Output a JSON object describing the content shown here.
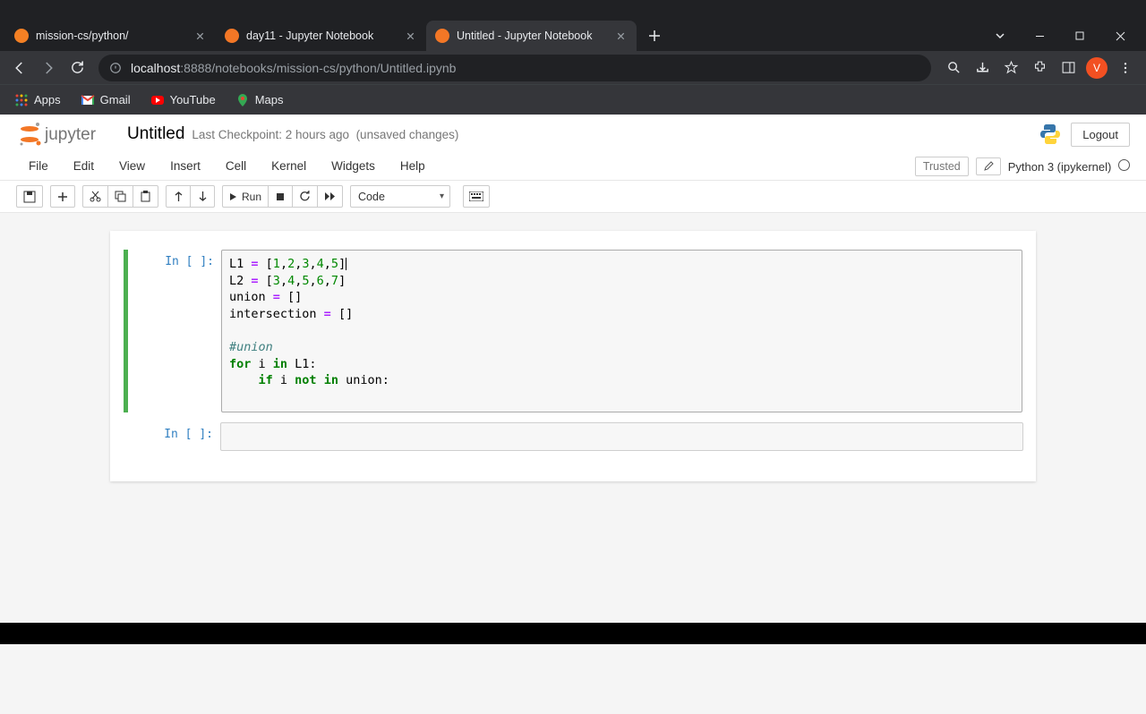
{
  "browser": {
    "tabs": [
      {
        "label": "mission-cs/python/",
        "favicon_color": "#f48024"
      },
      {
        "label": "day11 - Jupyter Notebook",
        "favicon_color": "#f37726"
      },
      {
        "label": "Untitled - Jupyter Notebook",
        "favicon_color": "#f37726"
      }
    ],
    "active_tab": 2,
    "url_host": "localhost",
    "url_port": ":8888",
    "url_path": "/notebooks/mission-cs/python/Untitled.ipynb",
    "avatar_letter": "V",
    "bookmarks": [
      {
        "label": "Apps",
        "icon": "apps"
      },
      {
        "label": "Gmail",
        "icon": "gmail"
      },
      {
        "label": "YouTube",
        "icon": "youtube"
      },
      {
        "label": "Maps",
        "icon": "maps"
      }
    ]
  },
  "jupyter": {
    "title": "Untitled",
    "checkpoint": "Last Checkpoint: 2 hours ago",
    "unsaved": "(unsaved changes)",
    "logout": "Logout",
    "menus": [
      "File",
      "Edit",
      "View",
      "Insert",
      "Cell",
      "Kernel",
      "Widgets",
      "Help"
    ],
    "trusted": "Trusted",
    "kernel": "Python 3 (ipykernel)",
    "run_label": "Run",
    "celltype": "Code",
    "cells": [
      {
        "prompt": "In [ ]:",
        "selected": true,
        "lines": [
          {
            "t": "assign",
            "raw": "L1 = [1,2,3,4,5]"
          },
          {
            "t": "assign",
            "raw": "L2 = [3,4,5,6,7]"
          },
          {
            "t": "assign",
            "raw": "union = []"
          },
          {
            "t": "assign",
            "raw": "intersection = []"
          },
          {
            "t": "blank",
            "raw": ""
          },
          {
            "t": "comment",
            "raw": "#union"
          },
          {
            "t": "for",
            "raw": "for i in L1:"
          },
          {
            "t": "if",
            "raw": "    if i not in union:"
          },
          {
            "t": "blank",
            "raw": "        "
          }
        ]
      },
      {
        "prompt": "In [ ]:",
        "selected": false,
        "lines": []
      }
    ]
  }
}
